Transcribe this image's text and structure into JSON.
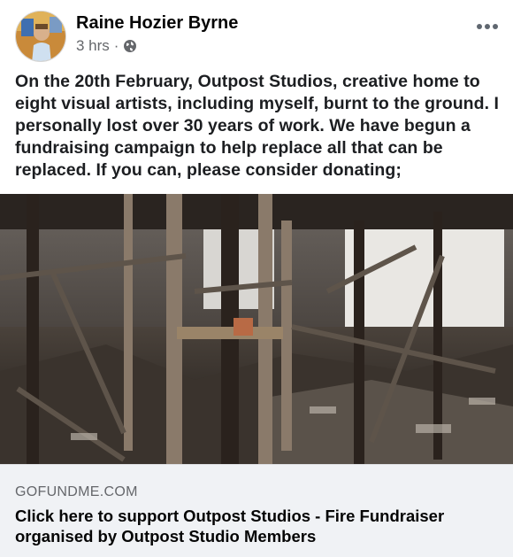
{
  "post": {
    "author": "Raine Hozier Byrne",
    "timestamp": "3 hrs",
    "separator": "·",
    "privacy_icon": "globe-icon",
    "more_icon": "more-options-icon",
    "body_text": "On the 20th February, Outpost Studios, creative home to eight visual artists, including myself, burnt to the ground. I personally lost over 30 years of work. We have begun a fundraising campaign to help replace all that can be replaced. If you can, please consider donating;"
  },
  "link_preview": {
    "domain": "GOFUNDME.COM",
    "title": "Click here to support Outpost Studios - Fire Fundraiser organised by Outpost Studio Members"
  },
  "colors": {
    "text": "#050505",
    "secondary": "#65676b",
    "card_background": "#f0f2f5"
  }
}
